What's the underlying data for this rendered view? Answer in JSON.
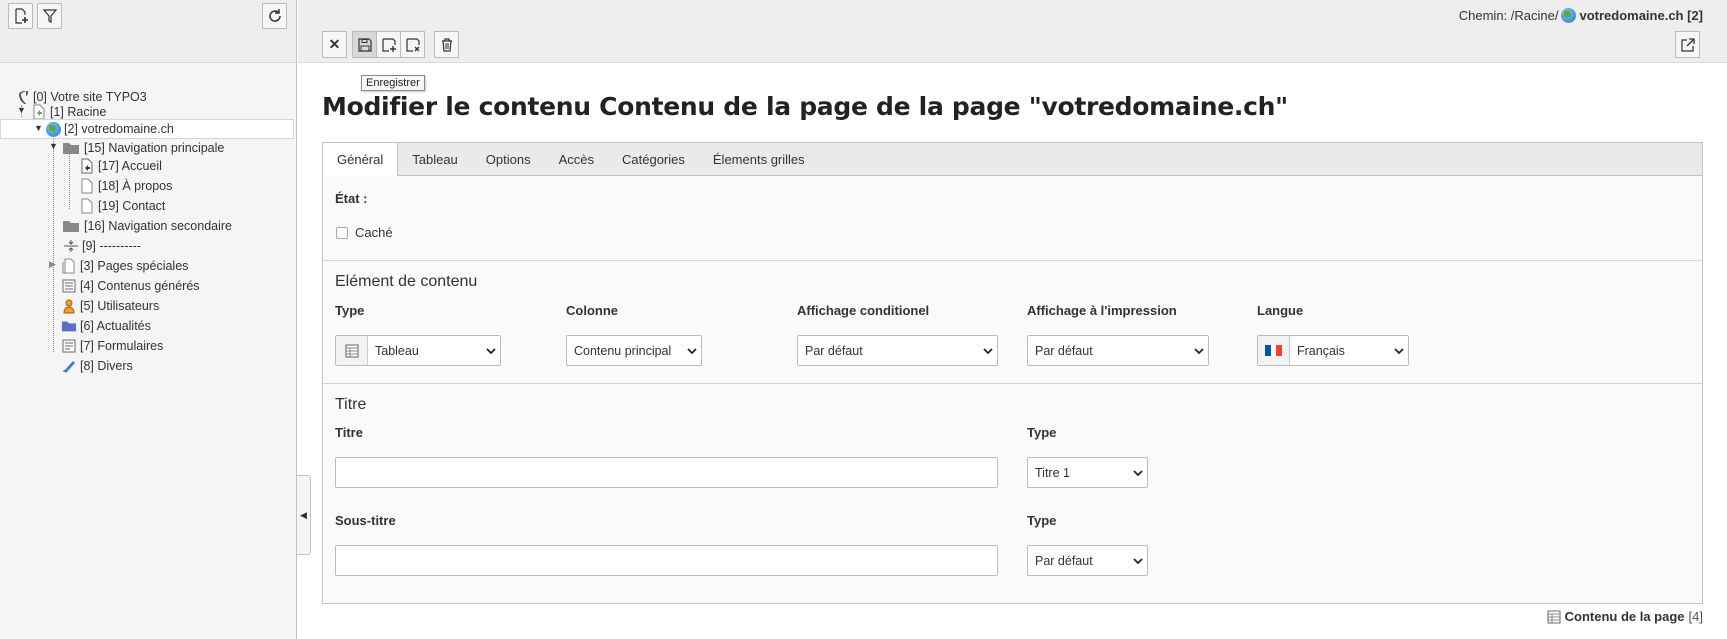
{
  "tree_toolbar": {
    "new_page_icon": "new-page-icon",
    "filter_icon": "filter-icon",
    "refresh_icon": "refresh-icon"
  },
  "tree": {
    "root": "[0] Votre site TYPO3",
    "items": [
      {
        "label": "[1] Racine",
        "icon": "page-shortcut-icon"
      },
      {
        "label": "[2] votredomaine.ch",
        "icon": "globe-icon",
        "selected": true
      },
      {
        "label": "[15] Navigation principale",
        "icon": "folder-icon"
      },
      {
        "label": "[17] Accueil",
        "icon": "page-shortcut-icon"
      },
      {
        "label": "[18] À propos",
        "icon": "page-icon"
      },
      {
        "label": "[19] Contact",
        "icon": "page-icon"
      },
      {
        "label": "[16] Navigation secondaire",
        "icon": "folder-icon"
      },
      {
        "label": "[9] ----------",
        "icon": "separator-icon"
      },
      {
        "label": "[3] Pages spéciales",
        "icon": "pages-icon"
      },
      {
        "label": "[4] Contenus générés",
        "icon": "list-icon"
      },
      {
        "label": "[5] Utilisateurs",
        "icon": "users-icon"
      },
      {
        "label": "[6] Actualités",
        "icon": "news-folder-icon"
      },
      {
        "label": "[7] Formulaires",
        "icon": "forms-icon"
      },
      {
        "label": "[8] Divers",
        "icon": "misc-icon"
      }
    ]
  },
  "header": {
    "path_label": "Chemin: /Racine/",
    "path_current": "votredomaine.ch [2]",
    "tooltip": "Enregistrer"
  },
  "page_title": "Modifier le contenu Contenu de la page de la page \"votredomaine.ch\"",
  "tabs": [
    "Général",
    "Tableau",
    "Options",
    "Accès",
    "Catégories",
    "Élements grilles"
  ],
  "state": {
    "label": "État :",
    "hidden_label": "Caché"
  },
  "content_element": {
    "heading": "Elément de contenu",
    "type_label": "Type",
    "type_value": "Tableau",
    "column_label": "Colonne",
    "column_value": "Contenu principal",
    "conditional_label": "Affichage conditionel",
    "conditional_value": "Par défaut",
    "print_label": "Affichage à l'impression",
    "print_value": "Par défaut",
    "lang_label": "Langue",
    "lang_value": "Français"
  },
  "title_section": {
    "heading": "Titre",
    "title_label": "Titre",
    "title_value": "",
    "title_type_label": "Type",
    "title_type_value": "Titre 1",
    "subtitle_label": "Sous-titre",
    "subtitle_value": "",
    "subtitle_type_label": "Type",
    "subtitle_type_value": "Par défaut"
  },
  "footer": {
    "record_label": "Contenu de la page",
    "record_id": "[4]"
  },
  "colors": {
    "flag_blue": "#0055a4",
    "flag_white": "#ffffff",
    "flag_red": "#ef4135"
  }
}
